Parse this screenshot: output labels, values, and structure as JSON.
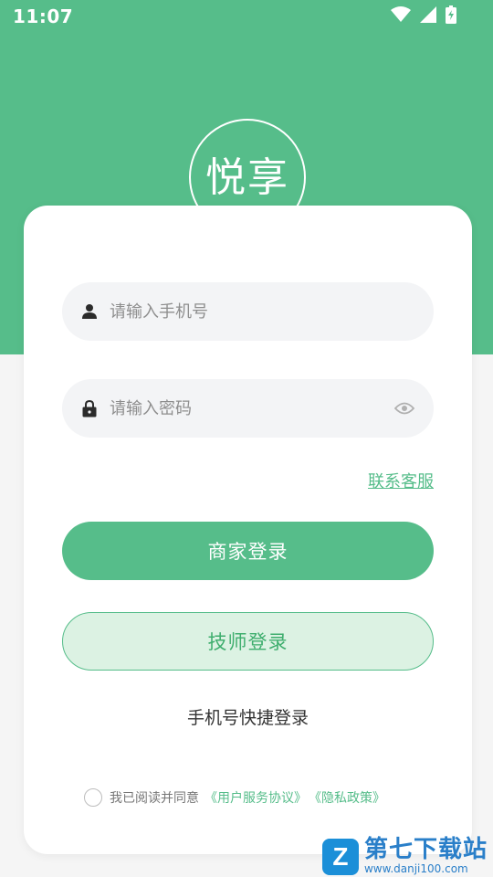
{
  "status_bar": {
    "time": "11:07"
  },
  "brand": {
    "logo_text": "悦享"
  },
  "login": {
    "phone_placeholder": "请输入手机号",
    "password_placeholder": "请输入密码",
    "contact_link": "联系客服",
    "merchant_button": "商家登录",
    "technician_button": "技师登录",
    "quick_login": "手机号快捷登录"
  },
  "agreement": {
    "text": "我已阅读并同意",
    "user_agreement": "《用户服务协议》",
    "privacy_policy": "《隐私政策》"
  },
  "watermark": {
    "badge": "Z",
    "title": "第七下载站",
    "url": "www.danji100.com"
  },
  "colors": {
    "primary": "#56bd8a",
    "primary_light": "#dcf2e3",
    "input_bg": "#f3f4f6",
    "page_bg": "#f5f5f5"
  }
}
